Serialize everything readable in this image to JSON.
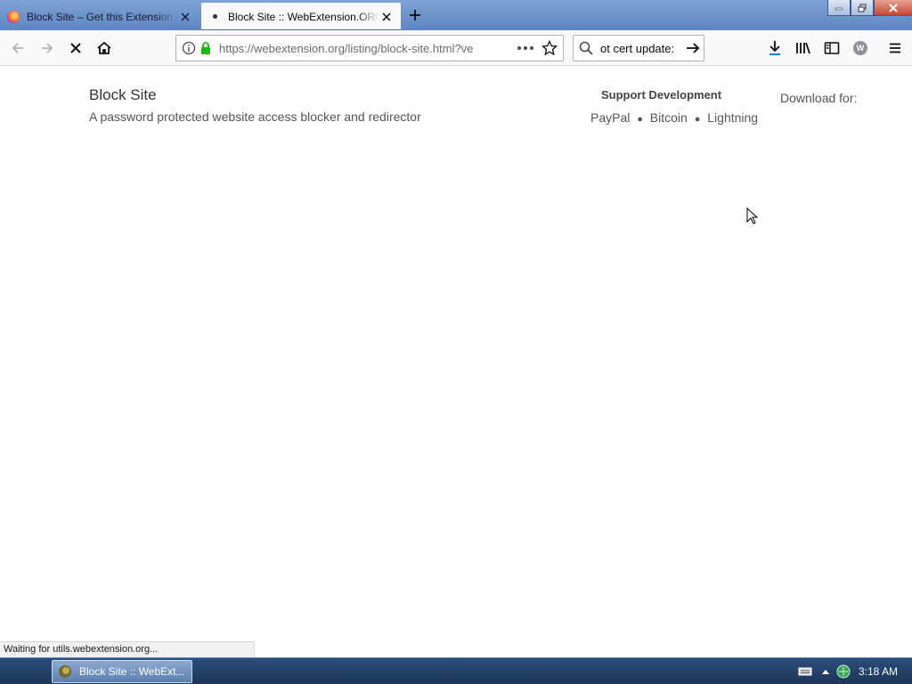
{
  "tabs": [
    {
      "label": "Block Site – Get this Extension for",
      "icon": "firefox-icon",
      "active": false
    },
    {
      "label": "Block Site :: WebExtension.ORG",
      "icon": "loading-dot-icon",
      "active": true
    }
  ],
  "navbar": {
    "url": "https://webextension.org/listing/block-site.html?ve",
    "search_query": "ot cert update:",
    "profile_initial": "W"
  },
  "page": {
    "title": "Block Site",
    "tagline": "A password protected website access blocker and redirector",
    "support_heading": "Support Development",
    "support_links": [
      "PayPal",
      "Bitcoin",
      "Lightning"
    ],
    "support_separator": "●",
    "download_label": "Download for:"
  },
  "status_text": "Waiting for utils.webextension.org...",
  "taskbar": {
    "item_label": "Block Site :: WebExt...",
    "clock": "3:18 AM"
  },
  "colors": {
    "lock_green": "#12bc00",
    "tab_active_bg": "#f9f9fa",
    "taskbar_bg": "#1c3658"
  }
}
